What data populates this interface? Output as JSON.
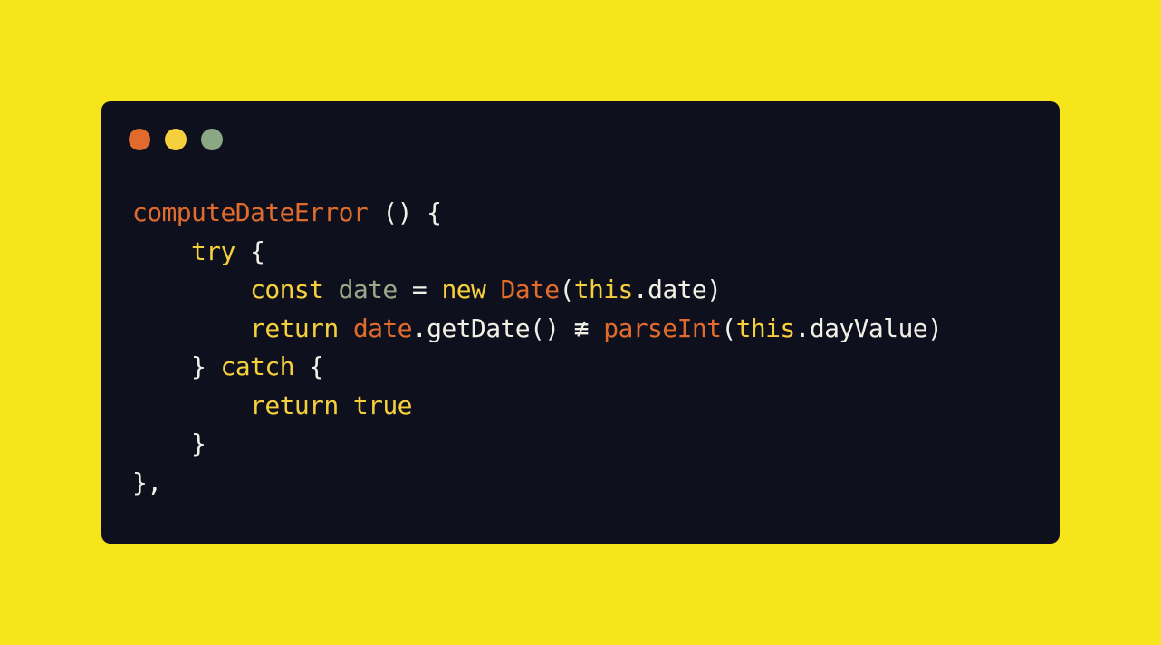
{
  "colors": {
    "background": "#f7e51c",
    "window_background": "#0e111d",
    "dot_close": "#e06b2d",
    "dot_minimize": "#f5cf3c",
    "dot_maximize": "#8aa884",
    "token_orange": "#e06b2d",
    "token_yellow": "#f5cf3c",
    "token_green": "#9aa88a",
    "token_white": "#f2efe6"
  },
  "window_dots": [
    "close-dot",
    "minimize-dot",
    "maximize-dot"
  ],
  "code": {
    "lines": [
      {
        "indent": "",
        "tokens": [
          {
            "text": "computeDateError",
            "color": "orange"
          },
          {
            "text": " () {",
            "color": "white"
          }
        ]
      },
      {
        "indent": "    ",
        "tokens": [
          {
            "text": "try",
            "color": "yellow"
          },
          {
            "text": " {",
            "color": "white"
          }
        ]
      },
      {
        "indent": "        ",
        "tokens": [
          {
            "text": "const",
            "color": "yellow"
          },
          {
            "text": " ",
            "color": "white"
          },
          {
            "text": "date",
            "color": "green"
          },
          {
            "text": " = ",
            "color": "white"
          },
          {
            "text": "new",
            "color": "yellow"
          },
          {
            "text": " ",
            "color": "white"
          },
          {
            "text": "Date",
            "color": "orange"
          },
          {
            "text": "(",
            "color": "white"
          },
          {
            "text": "this",
            "color": "yellow"
          },
          {
            "text": ".date)",
            "color": "white"
          }
        ]
      },
      {
        "indent": "        ",
        "tokens": [
          {
            "text": "return",
            "color": "yellow"
          },
          {
            "text": " ",
            "color": "white"
          },
          {
            "text": "date",
            "color": "orange"
          },
          {
            "text": ".getDate() ",
            "color": "white"
          },
          {
            "text": "≢",
            "color": "white"
          },
          {
            "text": " ",
            "color": "white"
          },
          {
            "text": "parseInt",
            "color": "orange"
          },
          {
            "text": "(",
            "color": "white"
          },
          {
            "text": "this",
            "color": "yellow"
          },
          {
            "text": ".dayValue)",
            "color": "white"
          }
        ]
      },
      {
        "indent": "    ",
        "tokens": [
          {
            "text": "} ",
            "color": "white"
          },
          {
            "text": "catch",
            "color": "yellow"
          },
          {
            "text": " {",
            "color": "white"
          }
        ]
      },
      {
        "indent": "        ",
        "tokens": [
          {
            "text": "return",
            "color": "yellow"
          },
          {
            "text": " ",
            "color": "white"
          },
          {
            "text": "true",
            "color": "yellow"
          }
        ]
      },
      {
        "indent": "    ",
        "tokens": [
          {
            "text": "}",
            "color": "white"
          }
        ]
      },
      {
        "indent": "",
        "tokens": [
          {
            "text": "},",
            "color": "white"
          }
        ]
      }
    ]
  }
}
